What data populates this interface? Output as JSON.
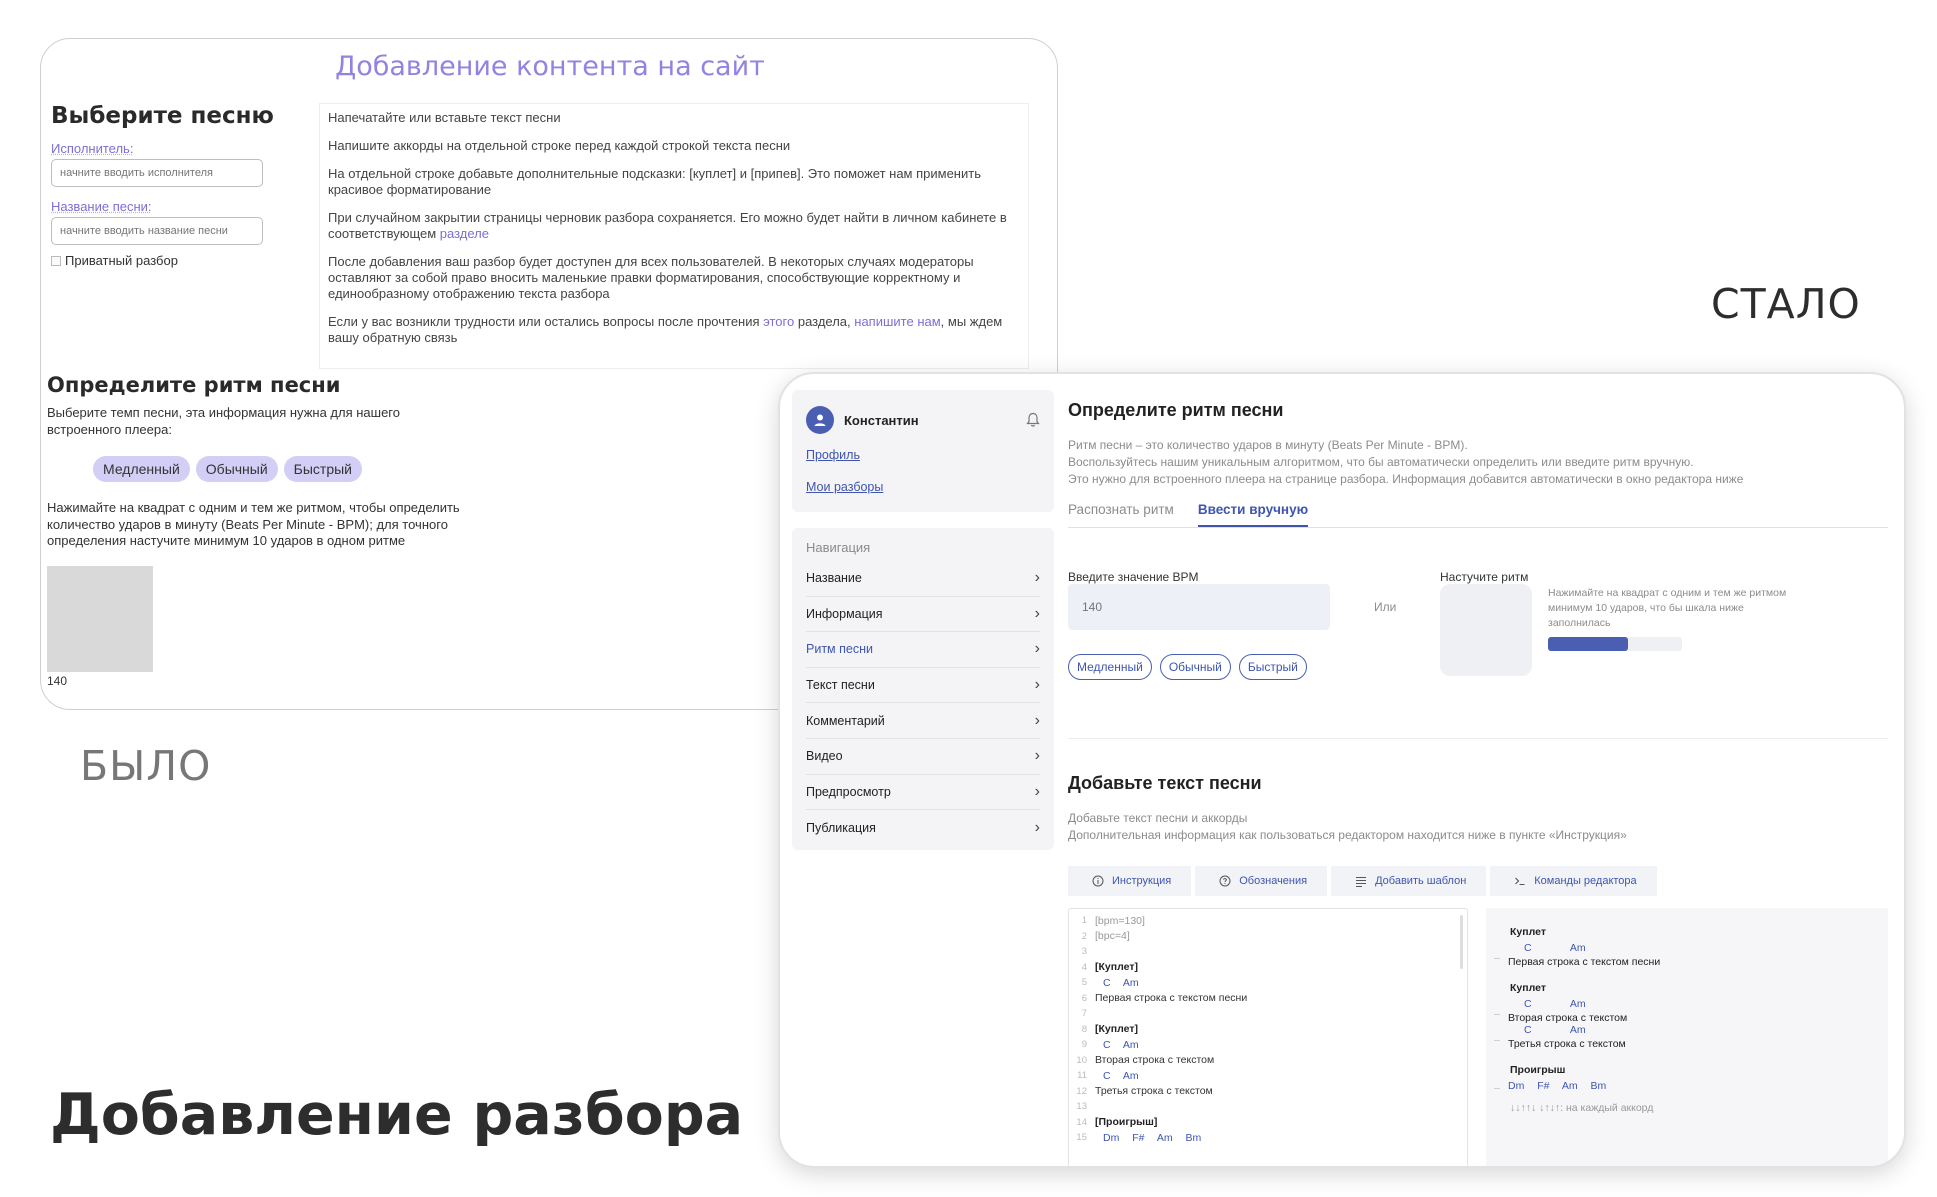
{
  "labels": {
    "was": "БЫЛО",
    "now": "СТАЛО",
    "bottom_title": "Добавление разбора"
  },
  "old": {
    "title": "Добавление контента на сайт",
    "choose_song": "Выберите песню",
    "artist_label": "Исполнитель:",
    "artist_placeholder": "начните вводить исполнителя",
    "song_label": "Название песни:",
    "song_placeholder": "начните вводить название песни",
    "private_label": "Приватный разбор",
    "info": {
      "p1": "Напечатайте или вставьте текст песни",
      "p2": "Напишите аккорды на отдельной строке перед каждой строкой текста песни",
      "p3": "На отдельной строке добавьте дополнительные подсказки: [куплет] и [припев]. Это поможет нам применить красивое форматирование",
      "p4_text": "При случайном закрытии страницы черновик разбора сохраняется. Его можно будет найти в личном кабинете в соответствующем ",
      "p4_link": "разделе",
      "p5": "После добавления ваш разбор будет доступен для всех пользователей. В некоторых случаях модераторы оставляют за собой право вносить маленькие правки форматирования, способствующие корректному и единообразному отображению текста разбора",
      "p6_a": "Если у вас возникли трудности или остались вопросы после прочтения ",
      "p6_link1": "этого",
      "p6_b": " раздела, ",
      "p6_link2": "напишите нам",
      "p6_c": ", мы ждем вашу обратную связь"
    },
    "rhythm_title": "Определите ритм песни",
    "rhythm_desc": "Выберите темп песни, эта информация нужна для нашего встроенного плеера:",
    "tempos": [
      "Медленный",
      "Обычный",
      "Быстрый"
    ],
    "tap_desc": "Нажимайте на квадрат с одним и тем же ритмом, чтобы определить количество ударов в минуту (Beats Per Minute - BPM); для точного определения настучите минимум 10 ударов в одном ритме",
    "bpm_value": "140"
  },
  "new": {
    "user": {
      "name": "Константин",
      "links": [
        "Профиль",
        "Мои разборы"
      ]
    },
    "nav": {
      "heading": "Навигация",
      "items": [
        "Название",
        "Информация",
        "Ритм песни",
        "Текст песни",
        "Комментарий",
        "Видео",
        "Предпросмотр",
        "Публикация"
      ],
      "active_index": 2
    },
    "rhythm": {
      "title": "Определите ритм песни",
      "desc1": "Ритм песни – это количество ударов в минуту (Beats Per Minute - BPM).",
      "desc2": "Воспользуйтесь нашим уникальным алгоритмом, что бы автоматически определить или введите ритм вручную.",
      "desc3": "Это нужно для встроенного плеера на странице разбора. Информация добавится автоматически в окно редактора ниже",
      "tabs": [
        "Распознать ритм",
        "Ввести вручную"
      ],
      "active_tab": 1,
      "bpm_label": "Введите значение BPM",
      "bpm_placeholder": "140",
      "or": "Или",
      "tempos": [
        "Медленный",
        "Обычный",
        "Быстрый"
      ],
      "tap_label": "Настучите ритм",
      "tap_hint": "Нажимайте на квадрат с одним и тем же ритмом минимум 10 ударов, что бы шкала ниже заполнилась",
      "tap_progress": 0.6
    },
    "text": {
      "title": "Добавьте текст песни",
      "desc1": "Добавьте текст песни и аккорды",
      "desc2": "Дополнительная информация как пользоваться редактором находится ниже в пункте «Инструкция»",
      "toolbar": [
        "Инструкция",
        "Обозначения",
        "Добавить шаблон",
        "Команды редактора"
      ],
      "editor_lines": [
        {
          "n": "1",
          "t": "[bpm=130]",
          "k": "meta"
        },
        {
          "n": "2",
          "t": "[bpc=4]",
          "k": "meta"
        },
        {
          "n": "3",
          "t": "",
          "k": "meta"
        },
        {
          "n": "4",
          "t": "[Куплет]",
          "k": "tag"
        },
        {
          "n": "5",
          "t": "C   Am",
          "k": "chord"
        },
        {
          "n": "6",
          "t": "Первая строка с текстом песни",
          "k": "text"
        },
        {
          "n": "7",
          "t": "",
          "k": "text"
        },
        {
          "n": "8",
          "t": "[Куплет]",
          "k": "tag"
        },
        {
          "n": "9",
          "t": "C   Am",
          "k": "chord"
        },
        {
          "n": "10",
          "t": "Вторая строка с текстом",
          "k": "text"
        },
        {
          "n": "11",
          "t": "C   Am",
          "k": "chord"
        },
        {
          "n": "12",
          "t": "Третья строка с текстом",
          "k": "text"
        },
        {
          "n": "13",
          "t": "",
          "k": "text"
        },
        {
          "n": "14",
          "t": "[Проигрыш]",
          "k": "tag"
        },
        {
          "n": "15",
          "t": "Dm  F#  Am  Bm",
          "k": "chord"
        }
      ],
      "preview": {
        "b1_tag": "Куплет",
        "b1_chords": "C Am",
        "b1_line": "Первая строка с текстом песни",
        "b2_tag": "Куплет",
        "b2_chords1": "C Am",
        "b2_line1": "Вторая строка с текстом",
        "b2_chords2": "C Am",
        "b2_line2": "Третья строка с текстом",
        "b3_tag": "Проигрыш",
        "b3_chords": "Dm F# Am Bm",
        "strum": "↓↓↑↑↓ ↓↑↓↑: на каждый аккорд"
      }
    }
  },
  "colors": {
    "old_accent": "#9183e2",
    "new_accent": "#3f55b0",
    "progress_fill": "#4a5fb2"
  }
}
